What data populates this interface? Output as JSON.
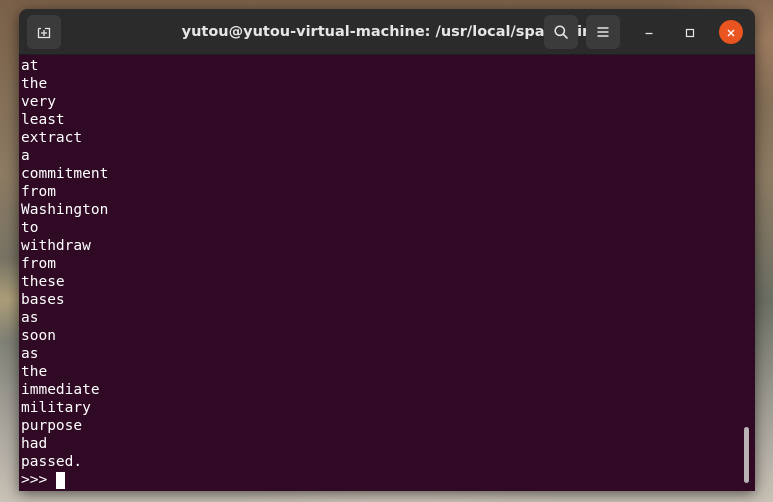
{
  "window": {
    "title": "yutou@yutou-virtual-machine: /usr/local/spark/bin"
  },
  "titlebar": {
    "new_tab_icon": "new-tab-icon",
    "search_icon": "search-icon",
    "menu_icon": "hamburger-menu-icon",
    "minimize_icon": "minimize-icon",
    "maximize_icon": "maximize-icon",
    "close_icon": "close-icon",
    "close_color": "#e95420"
  },
  "terminal": {
    "background": "#300a24",
    "lines": [
      "at",
      "the",
      "very",
      "least",
      "extract",
      "a",
      "commitment",
      "from",
      "Washington",
      "to",
      "withdraw",
      "from",
      "these",
      "bases",
      "as",
      "soon",
      "as",
      "the",
      "immediate",
      "military",
      "purpose",
      "had",
      "passed."
    ],
    "prompt": ">>>"
  }
}
